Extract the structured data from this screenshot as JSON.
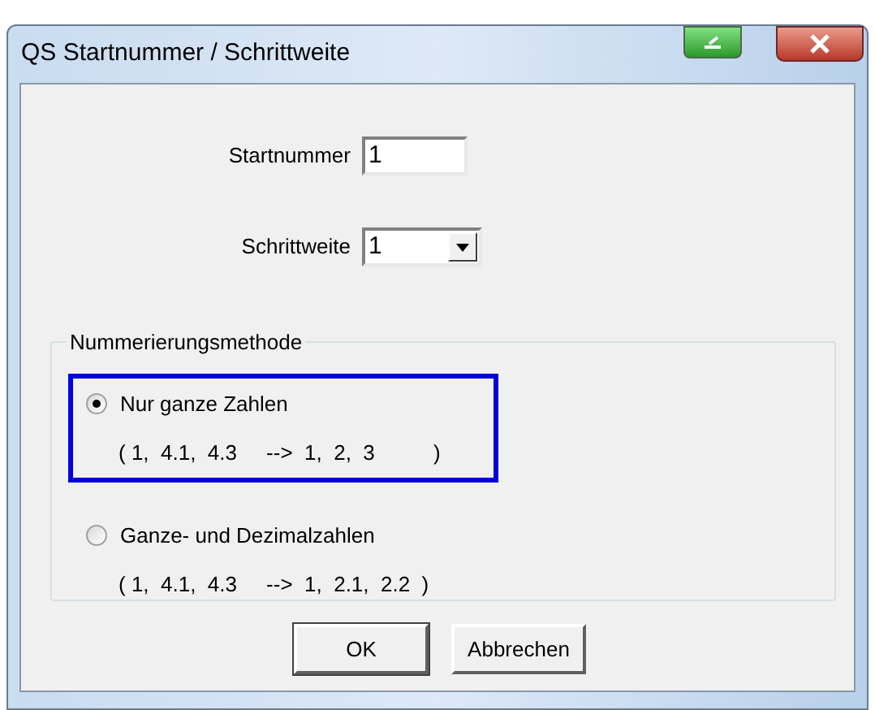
{
  "window": {
    "title": "QS Startnummer / Schrittweite"
  },
  "fields": [
    {
      "kind": "text",
      "label": "Startnummer",
      "value": "1"
    },
    {
      "kind": "combo",
      "label": "Schrittweite",
      "value": "1"
    }
  ],
  "group": {
    "title": "Nummerierungsmethode",
    "options": [
      {
        "label": "Nur ganze Zahlen",
        "example": "( 1,  4.1,  4.3     -->  1,  2,  3          )",
        "selected": true,
        "highlighted": true
      },
      {
        "label": "Ganze- und Dezimalzahlen",
        "example": "( 1,  4.1,  4.3     -->  1,  2.1,  2.2  )",
        "selected": false,
        "highlighted": false
      }
    ]
  },
  "buttons": [
    {
      "label": "OK",
      "default": true
    },
    {
      "label": "Abbrechen",
      "default": false
    }
  ]
}
